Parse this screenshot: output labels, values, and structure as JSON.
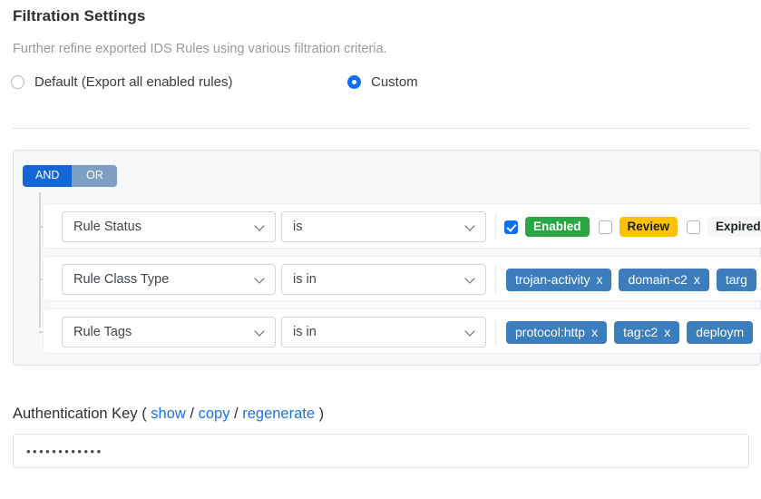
{
  "header": {
    "title": "Filtration Settings",
    "subtitle": "Further refine exported IDS Rules using various filtration criteria."
  },
  "mode_radios": [
    {
      "label": "Default (Export all enabled rules)",
      "selected": false
    },
    {
      "label": "Custom",
      "selected": true
    }
  ],
  "filter_panel": {
    "logic": {
      "and_label": "AND",
      "or_label": "OR",
      "active": "AND"
    },
    "rows": [
      {
        "field": "Rule Status",
        "operator": "is",
        "value_type": "checkbox-badges",
        "checkboxes": [
          {
            "label": "Enabled",
            "checked": true,
            "style": "enabled"
          },
          {
            "label": "Review",
            "checked": false,
            "style": "review"
          },
          {
            "label": "Expired",
            "checked": false,
            "style": "expired"
          }
        ]
      },
      {
        "field": "Rule Class Type",
        "operator": "is in",
        "value_type": "chips",
        "chips": [
          {
            "label": "trojan-activity",
            "remove": "x"
          },
          {
            "label": "domain-c2",
            "remove": "x"
          },
          {
            "label": "targ",
            "remove": ""
          }
        ]
      },
      {
        "field": "Rule Tags",
        "operator": "is in",
        "value_type": "chips",
        "chips": [
          {
            "label": "protocol:http",
            "remove": "x"
          },
          {
            "label": "tag:c2",
            "remove": "x"
          },
          {
            "label": "deploym",
            "remove": ""
          }
        ]
      }
    ]
  },
  "auth_key": {
    "label": "Authentication Key",
    "open_paren": "(",
    "close_paren": ")",
    "sep": "/",
    "links": [
      "show",
      "copy",
      "regenerate"
    ],
    "value": "••••••••••••"
  },
  "colors": {
    "accent_blue": "#0d6efd",
    "logic_active": "#1266d8",
    "logic_inactive": "#7d9fc4",
    "chip_blue": "#3b7dbd",
    "badge_enabled": "#28a745",
    "badge_review": "#ffc107",
    "badge_expired": "#f6f7f8",
    "link_blue": "#1a73e8",
    "panel_bg": "#f7f8f9",
    "panel_border": "#dcdce6"
  }
}
